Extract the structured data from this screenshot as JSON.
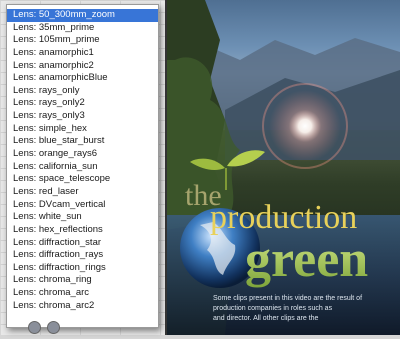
{
  "lens_menu": {
    "selected_index": 0,
    "items": [
      "Lens: 50_300mm_zoom",
      "Lens: 35mm_prime",
      "Lens: 105mm_prime",
      "Lens: anamorphic1",
      "Lens: anamorphic2",
      "Lens: anamorphicBlue",
      "Lens: rays_only",
      "Lens: rays_only2",
      "Lens: rays_only3",
      "Lens: simple_hex",
      "Lens: blue_star_burst",
      "Lens: orange_rays6",
      "Lens: california_sun",
      "Lens: space_telescope",
      "Lens: red_laser",
      "Lens: DVcam_vertical",
      "Lens: white_sun",
      "Lens: hex_reflections",
      "Lens: diffraction_star",
      "Lens: diffraction_rays",
      "Lens: diffraction_rings",
      "Lens: chroma_ring",
      "Lens: chroma_arc",
      "Lens: chroma_arc2"
    ]
  },
  "preview": {
    "logo_the": "the",
    "logo_production": "production",
    "logo_green": "green",
    "caption_line1": "Some clips present in this video are the result of",
    "caption_line2": "production companies in roles such as",
    "caption_line3": "and director.   All other clips are the"
  }
}
